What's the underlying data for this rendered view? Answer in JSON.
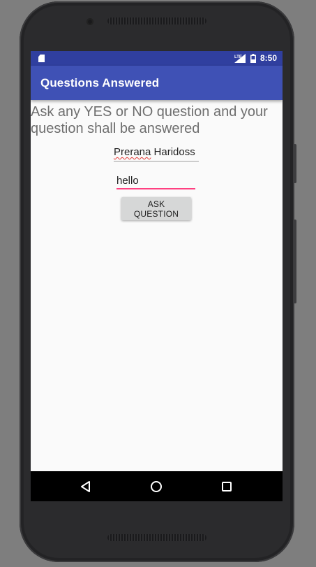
{
  "status_bar": {
    "time": "8:50",
    "network": "LTE",
    "icons": [
      "sd-card-icon",
      "signal-icon",
      "battery-icon"
    ]
  },
  "app_bar": {
    "title": "Questions Answered",
    "color": "#3f51b5"
  },
  "main": {
    "prompt": "Ask any YES or NO question and your question shall be answered",
    "name_first": "Prerana",
    "name_last": "Haridoss",
    "question_value": "hello",
    "ask_button_label": "ASK QUESTION"
  },
  "nav_bar": {
    "buttons": [
      "back-icon",
      "home-icon",
      "recents-icon"
    ]
  },
  "colors": {
    "status_bar": "#303f9f",
    "accent": "#ff4081",
    "background": "#fafafa"
  }
}
